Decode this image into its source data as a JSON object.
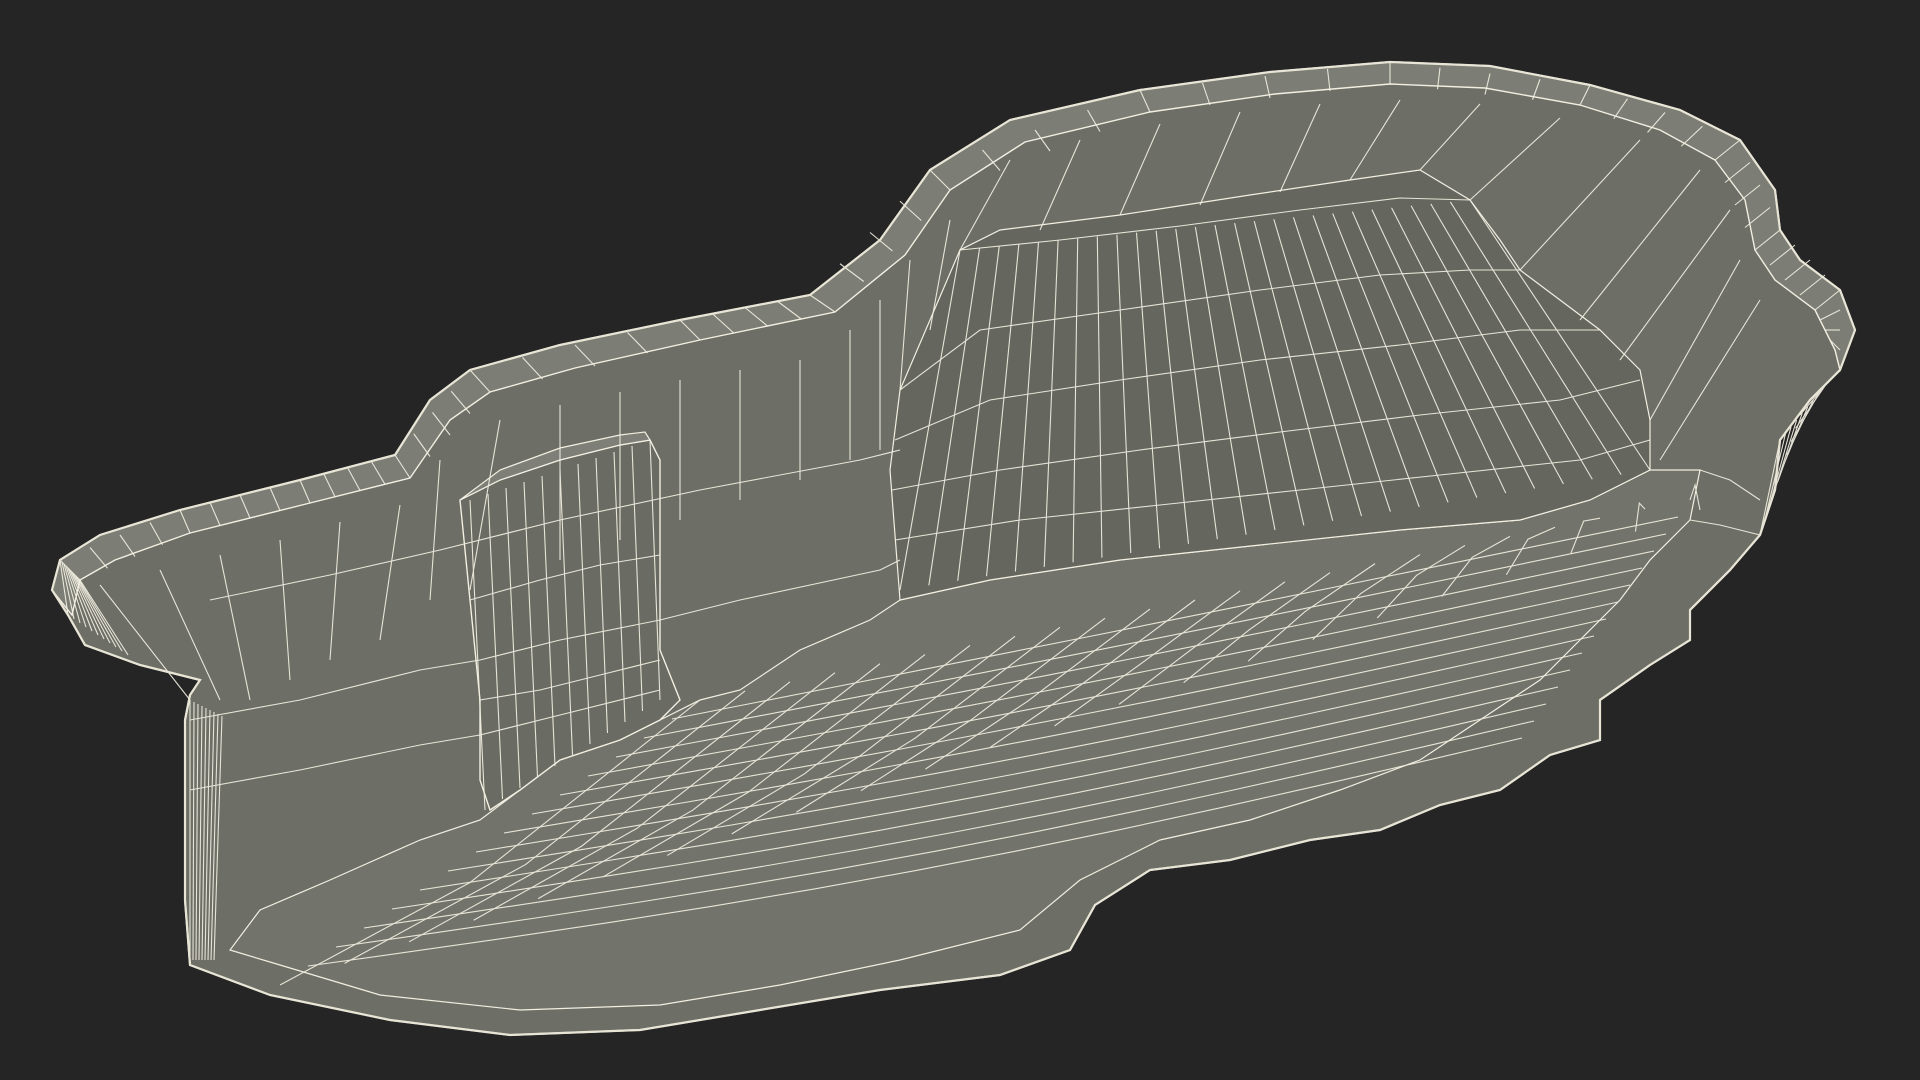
{
  "scene": {
    "subject": "pond-liner-wireframe",
    "colors": {
      "background": "#252525",
      "shell": "#6d6e65",
      "shell_shadow": "#5f6058",
      "floor": "#72736a",
      "rim": "#7c7d74",
      "wire": "#f2efe2",
      "outline": "#d9d6c8"
    }
  }
}
